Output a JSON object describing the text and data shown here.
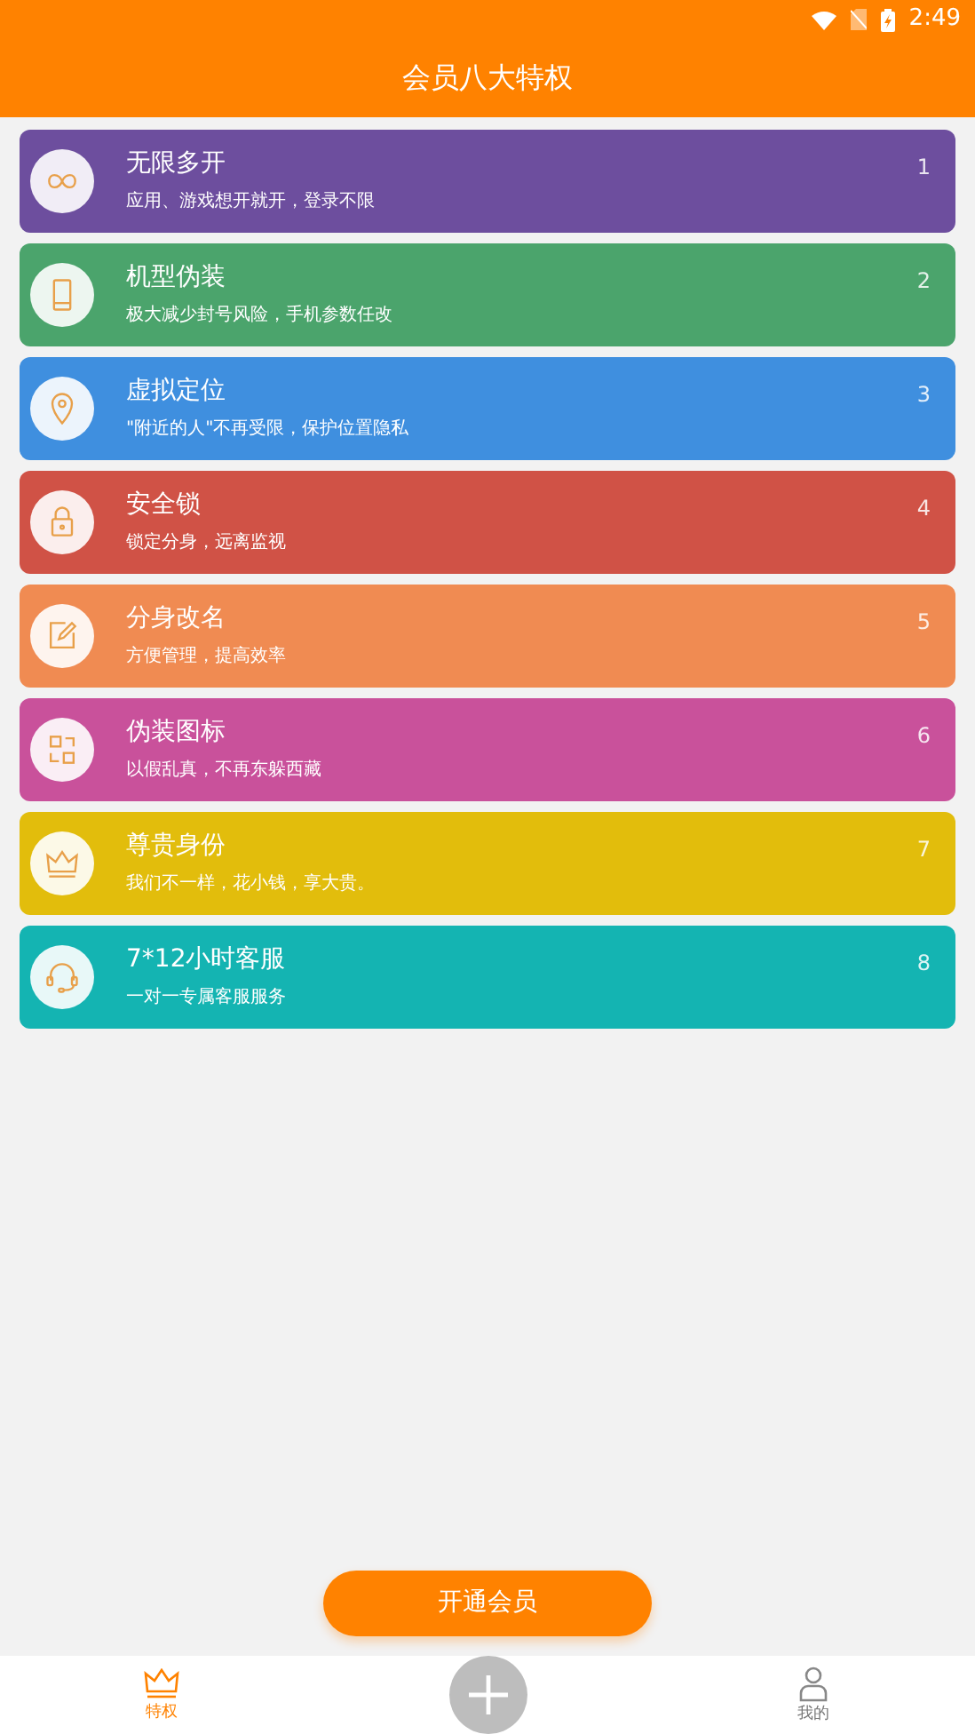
{
  "status_bar": {
    "time": "2:49"
  },
  "header": {
    "title": "会员八大特权"
  },
  "privileges": [
    {
      "title": "无限多开",
      "subtitle": "应用、游戏想开就开，登录不限",
      "number": "1",
      "color": "#6d4e9e"
    },
    {
      "title": "机型伪装",
      "subtitle": "极大减少封号风险，手机参数任改",
      "number": "2",
      "color": "#4ba46c"
    },
    {
      "title": "虚拟定位",
      "subtitle": "\"附近的人\"不再受限，保护位置隐私",
      "number": "3",
      "color": "#3f8fdf"
    },
    {
      "title": "安全锁",
      "subtitle": "锁定分身，远离监视",
      "number": "4",
      "color": "#d05246"
    },
    {
      "title": "分身改名",
      "subtitle": "方便管理，提高效率",
      "number": "5",
      "color": "#f08b52"
    },
    {
      "title": "伪装图标",
      "subtitle": "以假乱真，不再东躲西藏",
      "number": "6",
      "color": "#c9519b"
    },
    {
      "title": "尊贵身份",
      "subtitle": "我们不一样，花小钱，享大贵。",
      "number": "7",
      "color": "#e2bd0c"
    },
    {
      "title": "7*12小时客服",
      "subtitle": "一对一专属客服服务",
      "number": "8",
      "color": "#14b4b2"
    }
  ],
  "action_button": {
    "label": "开通会员"
  },
  "bottom_nav": [
    {
      "kind": "tab",
      "label": "特权",
      "selected": true
    },
    {
      "kind": "add"
    },
    {
      "kind": "tab",
      "label": "我的",
      "selected": false
    }
  ]
}
